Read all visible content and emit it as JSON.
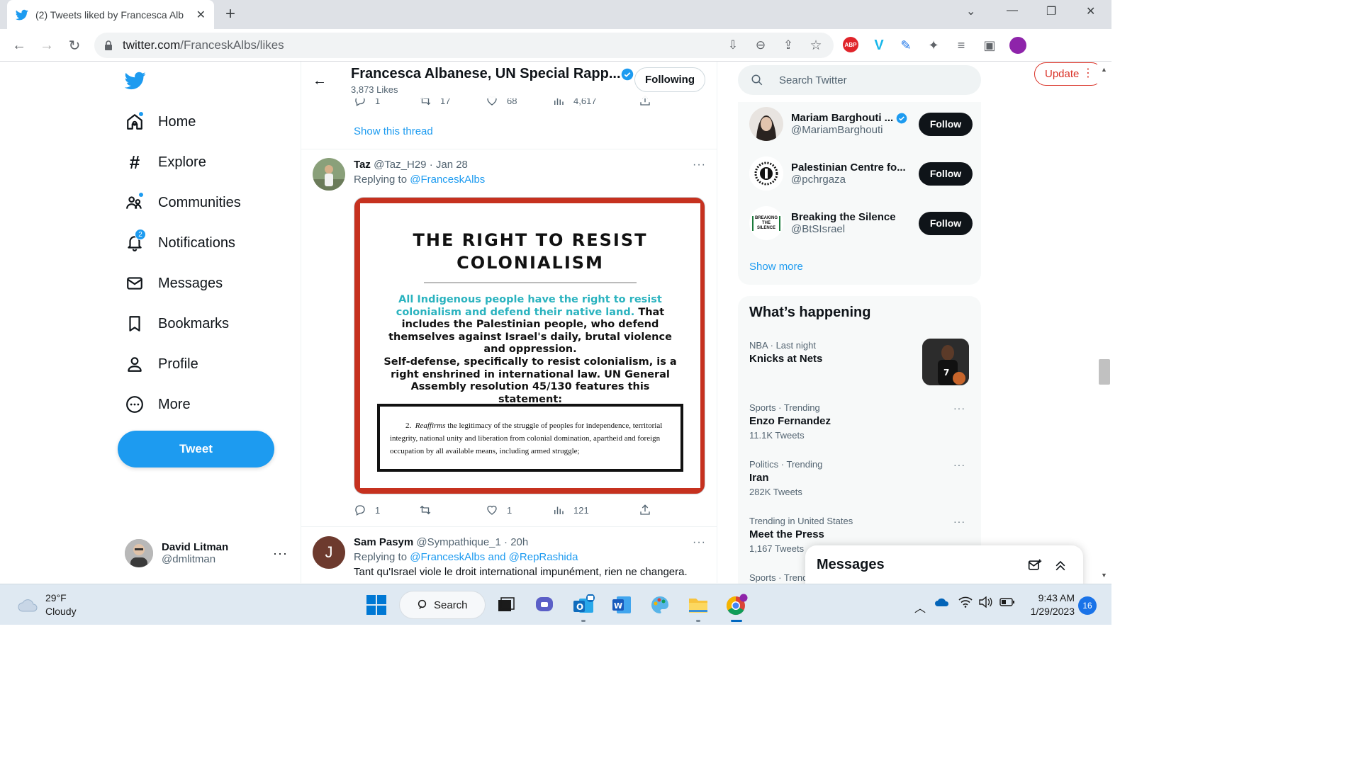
{
  "browser": {
    "tab_title": "(2) Tweets liked by Francesca Alb",
    "url_host": "twitter.com",
    "url_path": "/FranceskAlbs/likes",
    "update_label": "Update"
  },
  "sidebar": {
    "items": [
      {
        "label": "Home",
        "icon": "home-icon"
      },
      {
        "label": "Explore",
        "icon": "hashtag-icon"
      },
      {
        "label": "Communities",
        "icon": "communities-icon"
      },
      {
        "label": "Notifications",
        "icon": "bell-icon",
        "badge": "2"
      },
      {
        "label": "Messages",
        "icon": "envelope-icon"
      },
      {
        "label": "Bookmarks",
        "icon": "bookmark-icon"
      },
      {
        "label": "Profile",
        "icon": "person-icon"
      },
      {
        "label": "More",
        "icon": "more-circle-icon"
      }
    ],
    "tweet_button": "Tweet",
    "account": {
      "name": "David Litman",
      "handle": "@dmlitman"
    }
  },
  "header": {
    "title": "Francesca Albanese, UN Special Rapp...",
    "subtitle": "3,873 Likes",
    "following_label": "Following"
  },
  "prev_tweet": {
    "replies": "1",
    "retweets": "17",
    "likes": "68",
    "views": "4,617",
    "show_thread": "Show this thread"
  },
  "tweet1": {
    "name": "Taz",
    "handle": "@Taz_H29",
    "time": "· Jan 28",
    "replying_prefix": "Replying to",
    "replying_to": "@FranceskAlbs",
    "image": {
      "heading_line1": "THE RIGHT TO RESIST",
      "heading_line2": "COLONIALISM",
      "teal_text": "All Indigenous people have the right to resist colonialism and defend their native land.",
      "p1_rest": " That includes the Palestinian people, who defend themselves against Israel's daily, brutal violence and oppression.",
      "p2": "Self-defense, specifically to resist colonialism, is a right enshrined in international law. UN General Assembly resolution 45/130 features this statement:",
      "quote_num": "2.",
      "quote_italic": "Reaffirms",
      "quote_rest": " the legitimacy of the struggle of peoples for independence, territorial integrity, national unity and liberation from colonial domination, apartheid and foreign occupation by all available means, including armed struggle;"
    },
    "replies": "1",
    "retweets": "",
    "likes": "1",
    "views": "121"
  },
  "tweet2": {
    "name": "Sam Pasym",
    "handle": "@Sympathique_1",
    "time": "· 20h",
    "avatar_letter": "J",
    "replying_prefix": "Replying to",
    "replying_to": "@FranceskAlbs and @RepRashida",
    "text": "Tant qu'Israel viole le droit international impunément, rien ne changera."
  },
  "right": {
    "search_placeholder": "Search Twitter",
    "who_to_follow": [
      {
        "name": "Mariam Barghouti ...",
        "handle": "@MariamBarghouti",
        "verified": true
      },
      {
        "name": "Palestinian Centre fo...",
        "handle": "@pchrgaza",
        "verified": false
      },
      {
        "name": "Breaking the Silence",
        "handle": "@BtSIsrael",
        "verified": false
      }
    ],
    "follow_label": "Follow",
    "show_more": "Show more",
    "happening_title": "What’s happening",
    "trends": [
      {
        "meta": "NBA · Last night",
        "name": "Knicks at Nets",
        "count": ""
      },
      {
        "meta": "Sports · Trending",
        "name": "Enzo Fernandez",
        "count": "11.1K Tweets"
      },
      {
        "meta": "Politics · Trending",
        "name": "Iran",
        "count": "282K Tweets"
      },
      {
        "meta": "Trending in United States",
        "name": "Meet the Press",
        "count": "1,167 Tweets"
      },
      {
        "meta": "Sports · Trenc",
        "name": "",
        "count": ""
      }
    ],
    "messages_title": "Messages",
    "breaking_logo_text": "BREAKING THE SILENCE"
  },
  "taskbar": {
    "temp": "29°F",
    "condition": "Cloudy",
    "search_label": "Search",
    "time": "9:43 AM",
    "date": "1/29/2023",
    "notifications": "16"
  },
  "colors": {
    "twitter_blue": "#1d9bf0",
    "text": "#0f1419",
    "muted": "#536471",
    "poster_red": "#c6311f",
    "poster_teal": "#2bb3bf"
  }
}
